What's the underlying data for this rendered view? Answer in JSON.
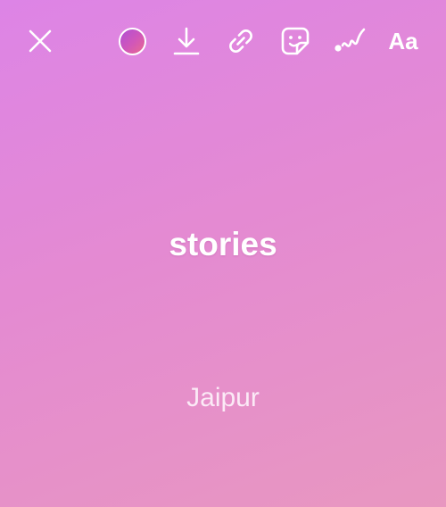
{
  "toolbar": {
    "close_icon": "close-icon",
    "color_picker": {
      "icon": "color-circle-icon",
      "color": "#d257b8"
    },
    "download_icon": "download-icon",
    "link_icon": "link-icon",
    "sticker_icon": "sticker-icon",
    "draw_icon": "draw-squiggle-icon",
    "text_label": "Aa"
  },
  "canvas": {
    "background_colors": [
      "#dd84e6",
      "#e48ad2",
      "#e897c0"
    ],
    "title": "stories",
    "location": "Jaipur"
  }
}
